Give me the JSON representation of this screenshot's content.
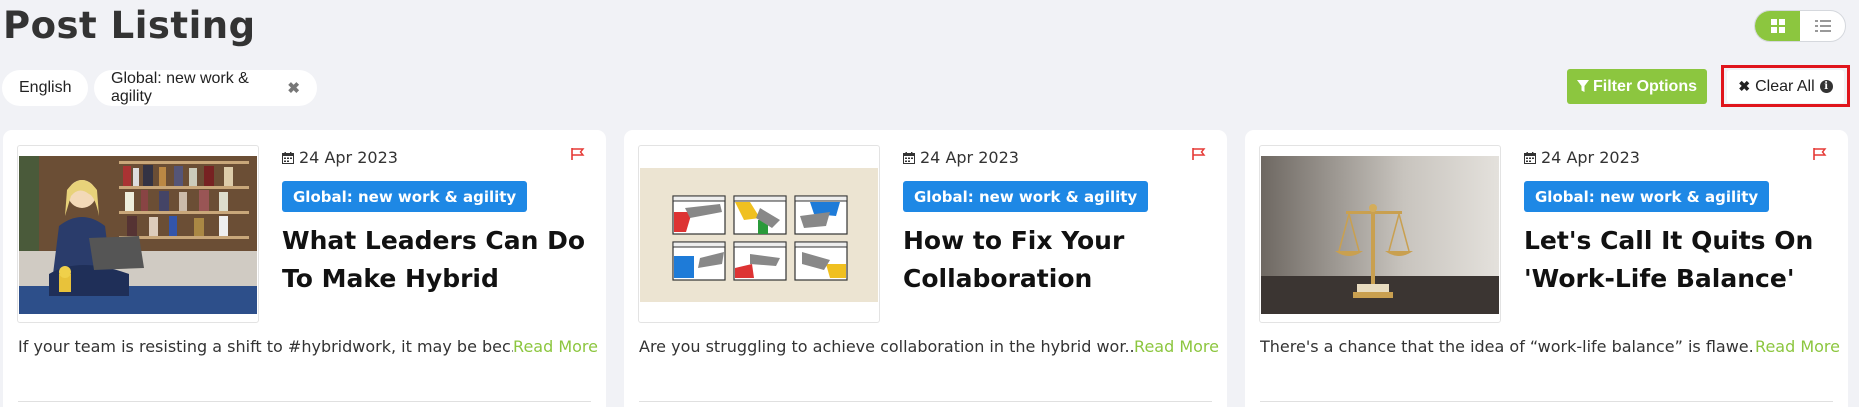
{
  "page": {
    "title": "Post Listing"
  },
  "view_toggle": {
    "grid_icon": "grid-icon",
    "list_icon": "list-icon",
    "active": "grid"
  },
  "filters": {
    "chips": [
      {
        "label": "English",
        "removable": false
      },
      {
        "label": "Global: new work & agility",
        "removable": true,
        "remove_glyph": "✖"
      }
    ],
    "filter_button": {
      "label": "Filter Options",
      "icon": "funnel-icon"
    },
    "clear_button": {
      "glyph": "✖",
      "label": "Clear All",
      "icon": "info-icon",
      "info_glyph": "i"
    }
  },
  "colors": {
    "accent_green": "#8cc63f",
    "tag_blue": "#1e88e5",
    "flag_red": "#e53935",
    "highlight_red": "#e0151c"
  },
  "posts": [
    {
      "date": "24 Apr 2023",
      "tag": "Global: new work & agility",
      "title": "What Leaders Can Do\nTo Make Hybrid Work…",
      "excerpt": "If your team is resisting a shift to #hybridwork, it may be bec...",
      "read_more": "Read More",
      "image": "woman-with-laptop-on-couch"
    },
    {
      "date": "24 Apr 2023",
      "tag": "Global: new work & agility",
      "title": "How to Fix Your\nCollaboration Problem…",
      "excerpt": "Are you struggling to achieve collaboration in the hybrid wor...",
      "read_more": "Read More",
      "image": "hands-exchanging-through-windows"
    },
    {
      "date": "24 Apr 2023",
      "tag": "Global: new work & agility",
      "title": "Let's Call It Quits On\n'Work-Life Balance'",
      "excerpt": "There's a chance that the idea of “work-life balance” is flawe...",
      "read_more": "Read More",
      "image": "brass-scales"
    }
  ]
}
